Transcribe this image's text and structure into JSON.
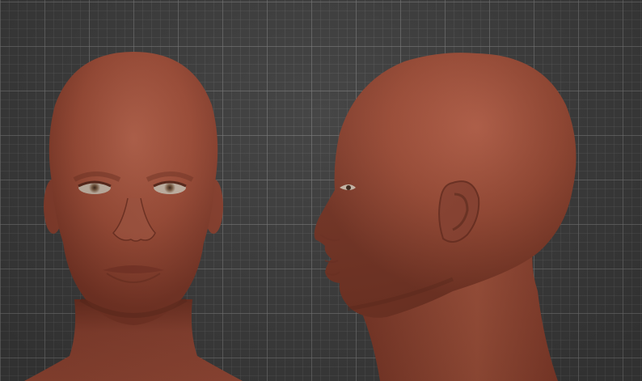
{
  "scene": {
    "background_color": "#3c3c3c",
    "grid_color": "#6e6e6e",
    "skin_base_color": "#9c4a34",
    "skin_light_color": "#b25e44",
    "skin_shadow_color": "#6e2e1f",
    "eye_color": "#7a5a40"
  },
  "models": [
    {
      "view": "front"
    },
    {
      "view": "side-profile"
    }
  ]
}
